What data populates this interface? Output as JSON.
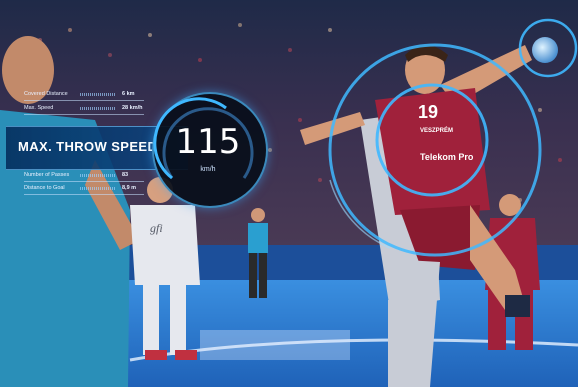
{
  "overlay": {
    "title": "MAX. THROW SPEED",
    "speed_value": "115",
    "speed_unit": "km/h",
    "stats": [
      {
        "label": "Covered Distance",
        "value": "6 km"
      },
      {
        "label": "Max. Speed",
        "value": "28 km/h"
      },
      {
        "label": "Number of Passes",
        "value": "83"
      },
      {
        "label": "Distance to Goal",
        "value": "8,9 m"
      }
    ]
  },
  "jersey": {
    "number": "19",
    "sponsor_top": "VESZPRÉM",
    "sponsor_bottom": "Telekom Pro"
  },
  "opponent_jersey": {
    "sponsor": "gfi"
  },
  "colors": {
    "accent_cyan": "#3fb8ff",
    "jersey_red": "#a0213b",
    "opponent_white": "#e6e8ee",
    "court_blue": "#2f7fd6",
    "overlay_dark": "#0a1222"
  }
}
